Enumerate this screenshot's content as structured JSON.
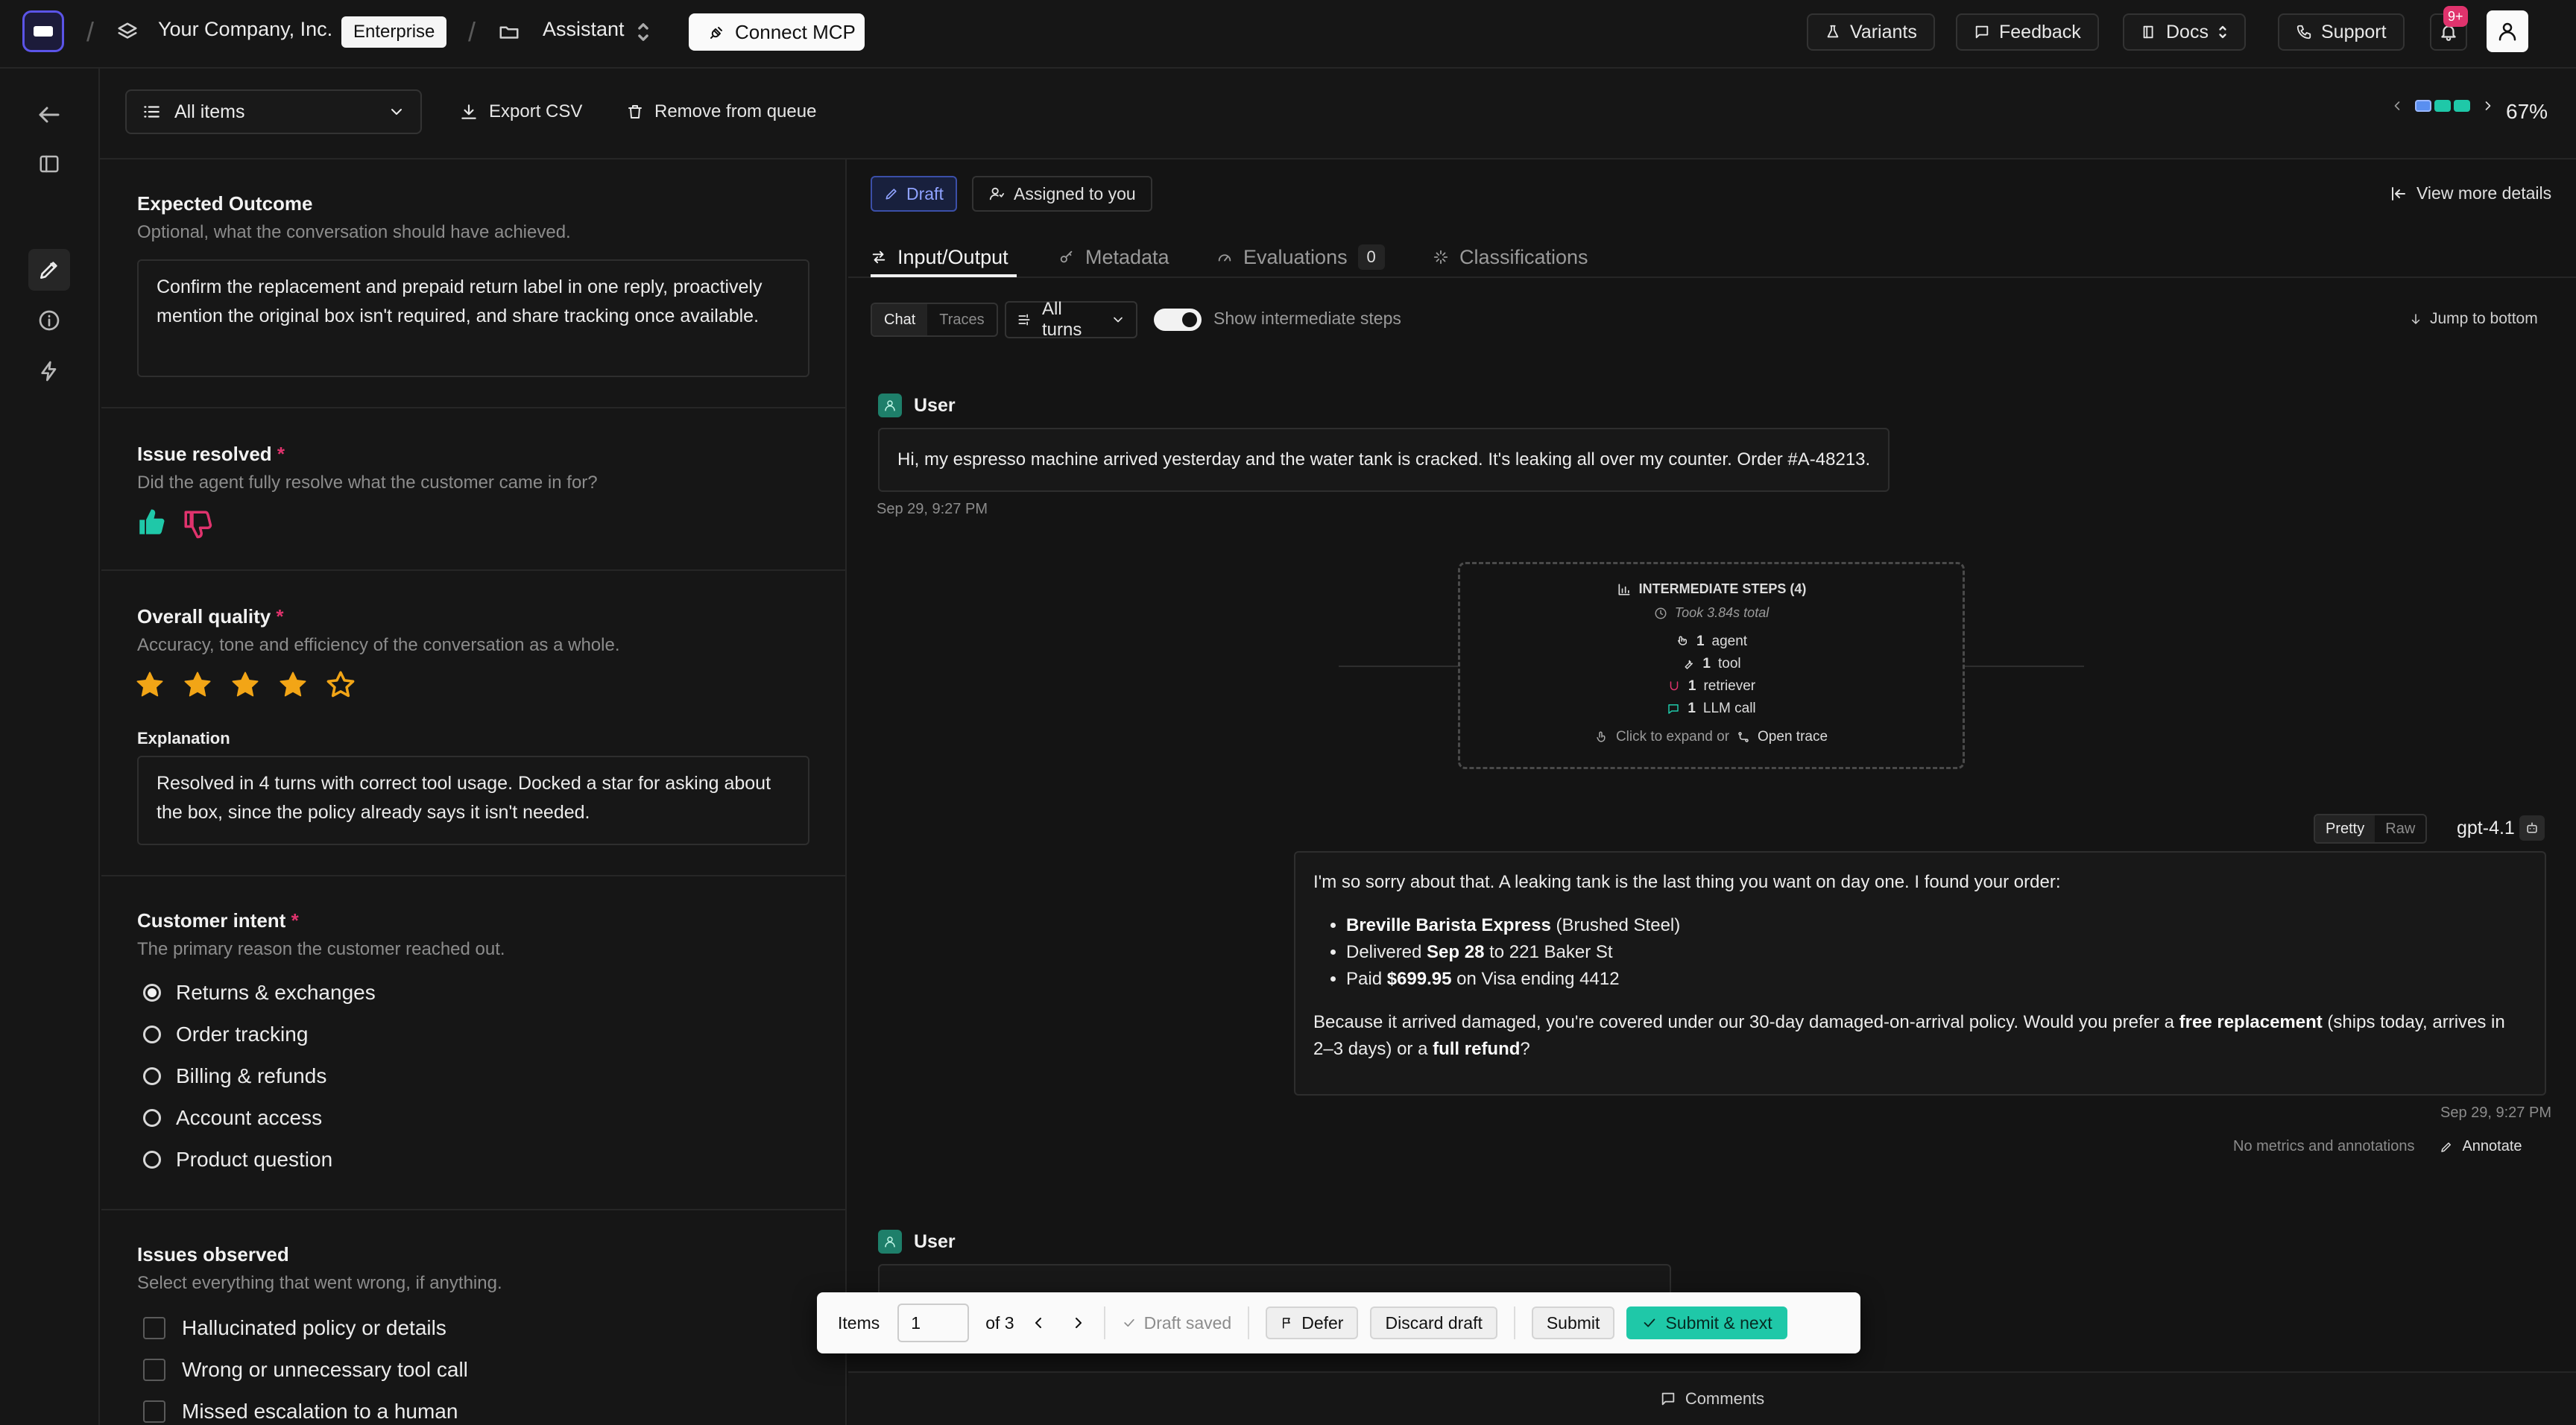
{
  "topbar": {
    "company": "Your Company, Inc.",
    "plan_badge": "Enterprise",
    "project": "Assistant",
    "connect_mcp": "Connect MCP",
    "variants": "Variants",
    "feedback": "Feedback",
    "docs": "Docs",
    "support": "Support",
    "notif_count": "9+"
  },
  "toolbar": {
    "filter": "All items",
    "export": "Export CSV",
    "remove": "Remove from queue",
    "progress_pct": "67%",
    "progress_dots": [
      "#5a8ff0",
      "#1fc8a8",
      "#1fc8a8"
    ]
  },
  "left": {
    "expected": {
      "title": "Expected Outcome",
      "sub": "Optional, what the conversation should have achieved.",
      "text": "Confirm the replacement and prepaid return label in one reply, proactively mention the original box isn't required, and share tracking once available."
    },
    "resolved": {
      "title": "Issue resolved",
      "req": "*",
      "sub": "Did the agent fully resolve what the customer came in for?",
      "value": "thumbs-up"
    },
    "quality": {
      "title": "Overall quality",
      "req": "*",
      "sub": "Accuracy, tone and efficiency of the conversation as a whole.",
      "rating": 4,
      "max": 5,
      "explanation_label": "Explanation",
      "explanation": "Resolved in 4 turns with correct tool usage. Docked a star for asking about the box, since the policy already says it isn't needed."
    },
    "intent": {
      "title": "Customer intent",
      "req": "*",
      "sub": "The primary reason the customer reached out.",
      "options": [
        "Returns & exchanges",
        "Order tracking",
        "Billing & refunds",
        "Account access",
        "Product question"
      ],
      "selected": "Returns & exchanges"
    },
    "issues": {
      "title": "Issues observed",
      "sub": "Select everything that went wrong, if anything.",
      "options": [
        "Hallucinated policy or details",
        "Wrong or unnecessary tool call",
        "Missed escalation to a human"
      ]
    }
  },
  "right": {
    "draft": "Draft",
    "assigned": "Assigned to you",
    "view_more": "View more details",
    "tabs": {
      "io": "Input/Output",
      "metadata": "Metadata",
      "evaluations": "Evaluations",
      "eval_count": "0",
      "classifications": "Classifications"
    },
    "view_chat": "Chat",
    "view_traces": "Traces",
    "turns": "All turns",
    "show_steps": "Show intermediate steps",
    "jump": "Jump to bottom",
    "user_label": "User",
    "user_msg": "Hi, my espresso machine arrived yesterday and the water tank is cracked. It's leaking all over my counter. Order #A-48213.",
    "user_time": "Sep 29, 9:27 PM",
    "steps": {
      "title": "INTERMEDIATE STEPS (4)",
      "took": "Took 3.84s total",
      "agent_n": "1",
      "agent": "agent",
      "tool_n": "1",
      "tool": "tool",
      "retriever_n": "1",
      "retriever": "retriever",
      "llm_n": "1",
      "llm": "LLM call",
      "click": "Click to expand or",
      "open": "Open trace"
    },
    "pretty": "Pretty",
    "raw": "Raw",
    "model": "gpt-4.1",
    "ai": {
      "intro": "I'm so sorry about that. A leaking tank is the last thing you want on day one. I found your order:",
      "item_b": "Breville Barista Express",
      "item_rest": " (Brushed Steel)",
      "deliv_pre": "Delivered ",
      "deliv_b": "Sep 28",
      "deliv_post": " to 221 Baker St",
      "paid_pre": "Paid ",
      "paid_b": "$699.95",
      "paid_post": " on Visa ending 4412",
      "p2_a": "Because it arrived damaged, you're covered under our 30-day damaged-on-arrival policy. Would you prefer a ",
      "p2_b1": "free replacement",
      "p2_c": " (ships today, arrives in 2–3 days) or a ",
      "p2_b2": "full refund",
      "p2_d": "?"
    },
    "ai_time": "Sep 29, 9:27 PM",
    "no_metrics": "No metrics and annotations",
    "annotate": "Annotate",
    "user2_label": "User"
  },
  "floatbar": {
    "items": "Items",
    "page": "1",
    "of": "of 3",
    "draft_saved": "Draft saved",
    "defer": "Defer",
    "discard": "Discard draft",
    "submit": "Submit",
    "submit_next": "Submit & next"
  },
  "comments": "Comments"
}
